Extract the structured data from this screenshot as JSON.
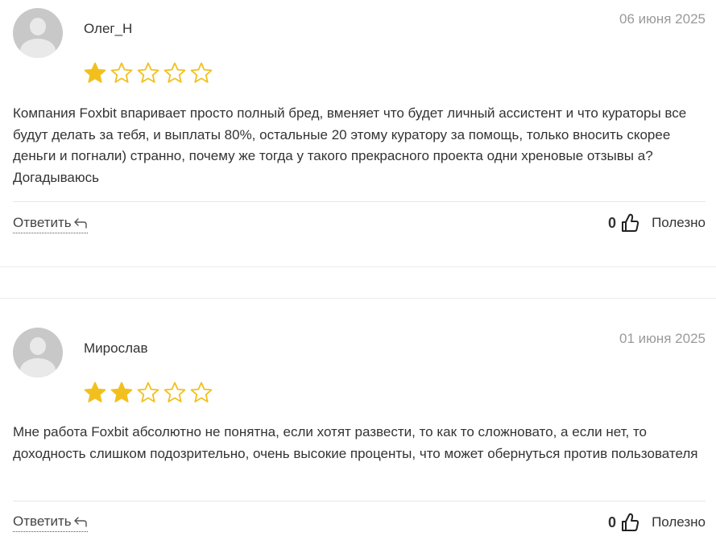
{
  "reviews": [
    {
      "author": "Олег_Н",
      "date": "06 июня 2025",
      "rating": 1,
      "rating_max": 5,
      "text": "Компания Foxbit впаривает просто полный бред, вменяет что будет личный ассистент и что кураторы все будут делать за тебя, и выплаты 80%, остальные 20 этому куратору за помощь, только вносить скорее деньги и погнали) странно, почему же тогда у такого прекрасного проекта одни хреновые отзывы а? Догадываюсь",
      "reply_label": "Ответить",
      "helpful_count": "0",
      "helpful_label": "Полезно"
    },
    {
      "author": "Мирослав",
      "date": "01 июня 2025",
      "rating": 2,
      "rating_max": 5,
      "text": "Мне работа Foxbit абсолютно не понятна, если хотят развести, то как то сложновато, а если нет, то доходность слишком подозрительно, очень высокие проценты, что может обернуться против пользователя",
      "reply_label": "Ответить",
      "helpful_count": "0",
      "helpful_label": "Полезно"
    }
  ],
  "colors": {
    "star_filled": "#f2c01e",
    "star_outline": "#f2c01e",
    "text": "#333333",
    "date": "#9a9a9a",
    "avatar_bg": "#c8c8c8"
  },
  "icons": {
    "star": "star-icon",
    "reply": "reply-arrow-icon",
    "like": "thumbs-up-icon",
    "avatar": "user-avatar-icon"
  }
}
